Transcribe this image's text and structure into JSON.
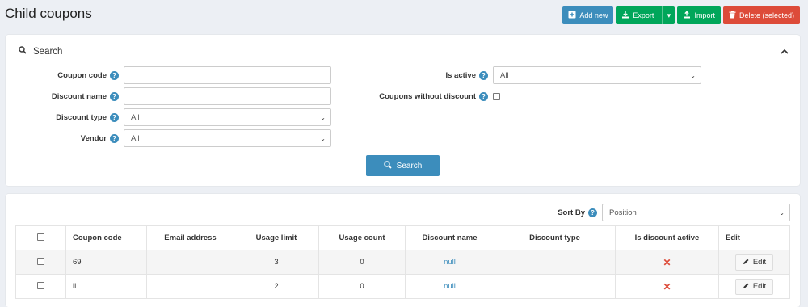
{
  "page": {
    "title": "Child coupons"
  },
  "actions": {
    "add_new": "Add new",
    "export": "Export",
    "import": "Import",
    "delete_selected": "Delete (selected)"
  },
  "search": {
    "header": "Search",
    "button": "Search",
    "coupon_code": {
      "label": "Coupon code",
      "value": ""
    },
    "discount_name": {
      "label": "Discount name",
      "value": ""
    },
    "discount_type": {
      "label": "Discount type",
      "value": "All"
    },
    "vendor": {
      "label": "Vendor",
      "value": "All"
    },
    "is_active": {
      "label": "Is active",
      "value": "All"
    },
    "coupons_without_discount": {
      "label": "Coupons without discount",
      "checked": false
    }
  },
  "list": {
    "sort_by": {
      "label": "Sort By",
      "value": "Position"
    },
    "columns": [
      "Coupon code",
      "Email address",
      "Usage limit",
      "Usage count",
      "Discount name",
      "Discount type",
      "Is discount active",
      "Edit"
    ],
    "rows": [
      {
        "coupon_code": "69",
        "email": "",
        "usage_limit": "3",
        "usage_count": "0",
        "discount_name": "null",
        "discount_type": "",
        "is_active": "✕",
        "edit": "Edit"
      },
      {
        "coupon_code": "ll",
        "email": "",
        "usage_limit": "2",
        "usage_count": "0",
        "discount_name": "null",
        "discount_type": "",
        "is_active": "✕",
        "edit": "Edit"
      }
    ]
  },
  "colors": {
    "primary": "#3c8dbc",
    "success": "#00a65a",
    "danger": "#dd4b39",
    "background": "#eceff4"
  },
  "icons": {
    "add": "plus-square-icon",
    "export": "download-icon",
    "import": "upload-icon",
    "delete": "trash-icon",
    "search": "search-icon",
    "help": "question-circle-icon",
    "edit": "pencil-icon",
    "inactive": "x-mark-icon"
  }
}
